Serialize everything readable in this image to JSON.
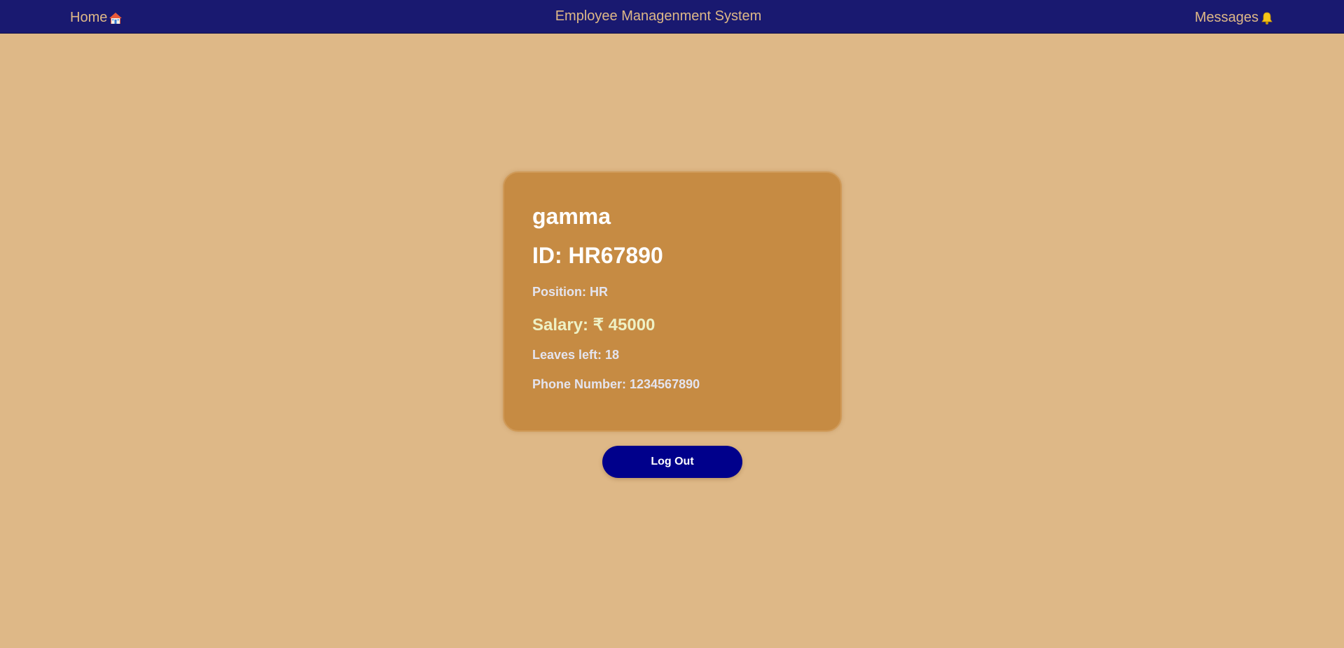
{
  "navbar": {
    "home_label": "Home",
    "home_icon": "house-icon",
    "title": "Employee Managenment System",
    "messages_label": "Messages",
    "messages_icon": "bell-icon"
  },
  "employee": {
    "name": "gamma",
    "id_text": "ID: HR67890",
    "position_text": "Position: HR",
    "salary_text": "Salary: ₹ 45000",
    "leaves_text": "Leaves left: 18",
    "phone_text": "Phone Number: 1234567890"
  },
  "actions": {
    "logout_label": "Log Out"
  },
  "colors": {
    "background": "#deb887",
    "navbar": "#191970",
    "nav_text": "#deb887",
    "card": "#c68b43",
    "logout_button": "#00008b"
  }
}
